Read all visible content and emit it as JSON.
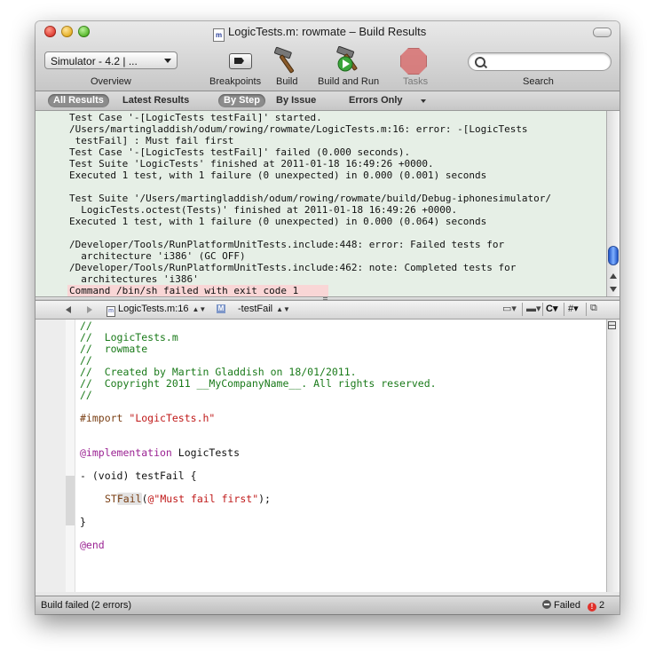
{
  "window": {
    "title": "LogicTests.m: rowmate – Build Results",
    "doc_icon_letter": "m"
  },
  "toolbar": {
    "scheme": "Simulator - 4.2 | ...",
    "overview_label": "Overview",
    "breakpoints_label": "Breakpoints",
    "build_label": "Build",
    "build_and_run_label": "Build and Run",
    "tasks_label": "Tasks",
    "search_label": "Search",
    "search_value": ""
  },
  "scopebar": {
    "all_results": "All Results",
    "latest_results": "Latest Results",
    "by_step": "By Step",
    "by_issue": "By Issue",
    "errors_only": "Errors Only"
  },
  "build_log": {
    "lines": [
      "Test Case '-[LogicTests testFail]' started.",
      "/Users/martingladdish/odum/rowing/rowmate/LogicTests.m:16: error: -[LogicTests",
      " testFail] : Must fail first",
      "Test Case '-[LogicTests testFail]' failed (0.000 seconds).",
      "Test Suite 'LogicTests' finished at 2011-01-18 16:49:26 +0000.",
      "Executed 1 test, with 1 failure (0 unexpected) in 0.000 (0.001) seconds",
      "",
      "Test Suite '/Users/martingladdish/odum/rowing/rowmate/build/Debug-iphonesimulator/",
      "  LogicTests.octest(Tests)' finished at 2011-01-18 16:49:26 +0000.",
      "Executed 1 test, with 1 failure (0 unexpected) in 0.000 (0.064) seconds",
      "",
      "/Developer/Tools/RunPlatformUnitTests.include:448: error: Failed tests for",
      "  architecture 'i386' (GC OFF)",
      "/Developer/Tools/RunPlatformUnitTests.include:462: note: Completed tests for",
      "  architectures 'i386'"
    ],
    "error_line": "Command /bin/sh failed with exit code 1"
  },
  "navbar": {
    "file": "LogicTests.m:16",
    "function": "-testFail",
    "lang_menu": "C",
    "hash_menu": "#"
  },
  "editor": {
    "comment_lines": [
      "//",
      "//  LogicTests.m",
      "//  rowmate",
      "//",
      "//  Created by Martin Gladdish on 18/01/2011.",
      "//  Copyright 2011 __MyCompanyName__. All rights reserved.",
      "//"
    ],
    "import_directive": "#import",
    "import_file": "\"LogicTests.h\"",
    "implementation_kw": "@implementation",
    "class_name": " LogicTests",
    "method_sig": "- (void) testFail {",
    "macro_prefix": "ST",
    "macro_hl": "Fail",
    "macro_open": "(",
    "macro_string": "@\"Must fail first\"",
    "macro_close": ");",
    "close_brace": "}",
    "end_kw": "@end"
  },
  "status": {
    "text": "Build failed (2 errors)",
    "failed_label": "Failed",
    "error_count": "2"
  }
}
